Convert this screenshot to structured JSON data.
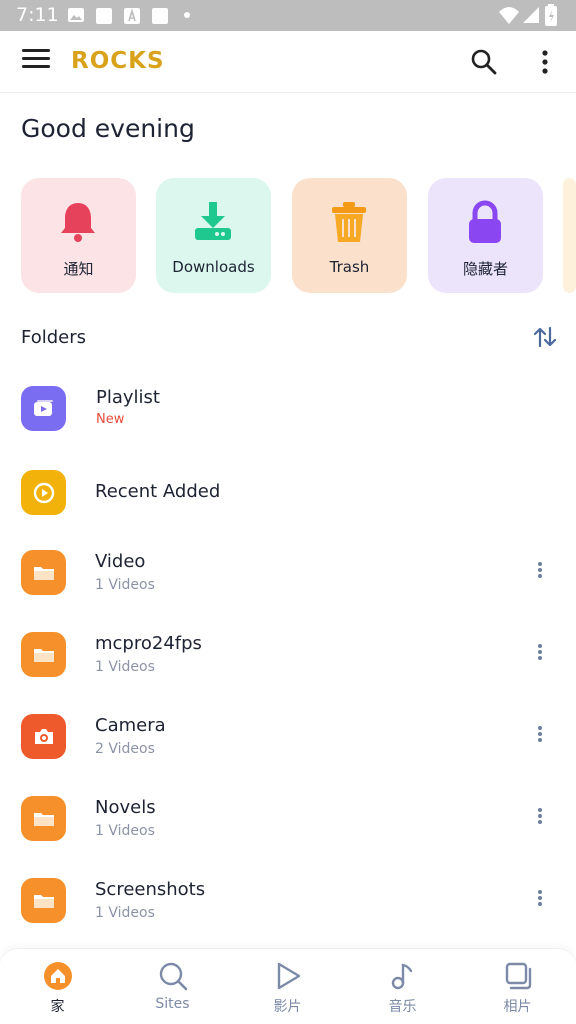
{
  "status_bar": {
    "time": "7:11"
  },
  "app_bar": {
    "logo": "ROCKS"
  },
  "greeting": "Good evening",
  "quick_tiles": [
    {
      "label": "通知",
      "icon": "bell-icon",
      "bg": "#fbe3e6",
      "color": "#e6425b"
    },
    {
      "label": "Downloads",
      "icon": "download-icon",
      "bg": "#dbf7ee",
      "color": "#1fc88e"
    },
    {
      "label": "Trash",
      "icon": "trash-icon",
      "bg": "#fbe0cc",
      "color": "#f59a16"
    },
    {
      "label": "隐藏者",
      "icon": "lock-icon",
      "bg": "#ece4fb",
      "color": "#8a46f0"
    }
  ],
  "folders": {
    "title": "Folders",
    "items": [
      {
        "name": "Playlist",
        "sub": "New",
        "icon": "playlist-icon"
      },
      {
        "name": "Recent Added",
        "sub": "",
        "icon": "recent-icon"
      },
      {
        "name": "Video",
        "sub": "1 Videos",
        "icon": "folder-icon"
      },
      {
        "name": "mcpro24fps",
        "sub": "1 Videos",
        "icon": "folder-icon"
      },
      {
        "name": "Camera",
        "sub": "2 Videos",
        "icon": "camera-icon"
      },
      {
        "name": "Novels",
        "sub": "1 Videos",
        "icon": "folder-icon"
      },
      {
        "name": "Screenshots",
        "sub": "1 Videos",
        "icon": "folder-icon"
      }
    ]
  },
  "bottom_nav": [
    {
      "label": "家",
      "icon": "home-icon",
      "active": true
    },
    {
      "label": "Sites",
      "icon": "search-icon",
      "active": false
    },
    {
      "label": "影片",
      "icon": "play-icon",
      "active": false
    },
    {
      "label": "音乐",
      "icon": "music-note-icon",
      "active": false
    },
    {
      "label": "相片",
      "icon": "photos-icon",
      "active": false
    }
  ],
  "colors": {
    "accent_gold": "#d9a21b",
    "folder_orange": "#f6902a",
    "camera_red": "#ee5a2c",
    "playlist_purple": "#7b6df2",
    "recent_yellow": "#f2b20a",
    "nav_active": "#f6902a"
  }
}
